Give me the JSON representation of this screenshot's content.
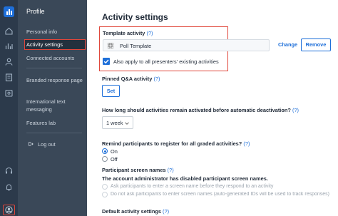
{
  "sidebar": {
    "title": "Profile",
    "items": [
      {
        "label": "Personal info"
      },
      {
        "label": "Activity settings"
      },
      {
        "label": "Connected accounts"
      },
      {
        "label": "Branded response page"
      },
      {
        "label": "International text messaging"
      },
      {
        "label": "Features lab"
      },
      {
        "label": "Log out"
      }
    ]
  },
  "page": {
    "title": "Activity settings",
    "template": {
      "label": "Template activity",
      "help": "(?)",
      "value": "Poll Template",
      "change": "Change",
      "remove": "Remove",
      "apply_all_label": "Also apply to all presenters' existing activities",
      "apply_all_checked": true
    },
    "pinned": {
      "label": "Pinned Q&A activity",
      "help": "(?)",
      "button": "Set"
    },
    "duration": {
      "label": "How long should activities remain activated before automatic deactivation?",
      "help": "(?)",
      "value": "1 week"
    },
    "remind": {
      "label": "Remind participants to register for all graded activities?",
      "help": "(?)",
      "options": [
        {
          "label": "On",
          "selected": true
        },
        {
          "label": "Off",
          "selected": false
        }
      ]
    },
    "screen_names": {
      "label": "Participant screen names",
      "help": "(?)",
      "notice": "The account administrator has disabled participant screen names.",
      "options": [
        {
          "label": "Ask participants to enter a screen name before they respond to an activity"
        },
        {
          "label": "Do not ask participants to enter screen names (auto-generated IDs will be used to track responses)"
        }
      ]
    },
    "default_settings": {
      "label": "Default activity settings",
      "help": "(?)"
    }
  },
  "colors": {
    "rail": "#2c3a4b",
    "sidebar": "#3a4858",
    "accent": "#1e6fd9",
    "highlight": "#e0463a"
  }
}
